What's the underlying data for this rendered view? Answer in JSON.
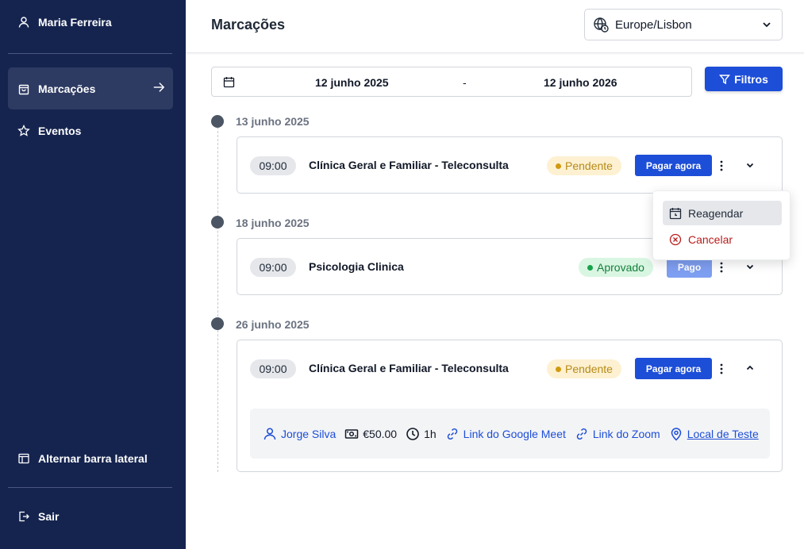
{
  "sidebar": {
    "user_name": "Maria Ferreira",
    "items": [
      {
        "label": "Marcações",
        "icon": "shopping-bag-icon",
        "active": true
      },
      {
        "label": "Eventos",
        "icon": "star-icon",
        "active": false
      }
    ],
    "toggle_label": "Alternar barra lateral",
    "logout_label": "Sair"
  },
  "header": {
    "title": "Marcações",
    "timezone": "Europe/Lisbon"
  },
  "filters": {
    "date_from": "12 junho 2025",
    "separator": "-",
    "date_to": "12 junho 2026",
    "filters_label": "Filtros"
  },
  "groups": [
    {
      "date": "13 junho 2025",
      "appointment": {
        "time": "09:00",
        "title": "Clínica Geral e Familiar - Teleconsulta",
        "status": "Pendente",
        "payment_label": "Pagar agora",
        "expanded": false
      }
    },
    {
      "date": "18 junho 2025",
      "appointment": {
        "time": "09:00",
        "title": "Psicologia Clinica",
        "status": "Aprovado",
        "payment_label": "Pago",
        "expanded": false
      }
    },
    {
      "date": "26 junho 2025",
      "appointment": {
        "time": "09:00",
        "title": "Clínica Geral e Familiar - Teleconsulta",
        "status": "Pendente",
        "payment_label": "Pagar agora",
        "expanded": true,
        "details": {
          "professional": "Jorge Silva",
          "price": "€50.00",
          "duration": "1h",
          "google_meet": "Link do Google Meet",
          "zoom": "Link do Zoom",
          "location": "Local de Teste"
        }
      }
    }
  ],
  "menu": {
    "reschedule": "Reagendar",
    "cancel": "Cancelar"
  },
  "colors": {
    "sidebar_bg": "#15244f",
    "primary": "#1d4ed8",
    "pending_bg": "#fdf1d2",
    "approved_bg": "#d9f6e2",
    "danger": "#b91c1c"
  }
}
